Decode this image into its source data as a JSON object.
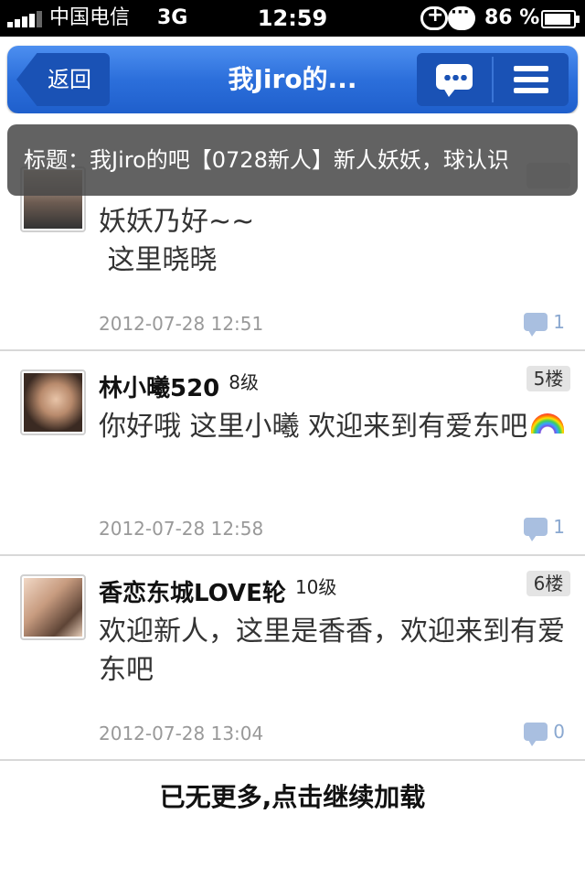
{
  "status_bar": {
    "carrier": "中国电信",
    "network": "3G",
    "time": "12:59",
    "battery": "86 %"
  },
  "nav": {
    "back_label": "返回",
    "title": "我Jiro的..."
  },
  "title_tip": "标题：我Jiro的吧【0728新人】新人妖妖，球认识",
  "posts": [
    {
      "name": "",
      "level": "",
      "floor": "",
      "content": "妖妖乃好~~\n 这里晓晓",
      "time": "2012-07-28 12:51",
      "replies": "1"
    },
    {
      "name": "林小曦520",
      "level": "8级",
      "floor": "5楼",
      "content": "你好哦 这里小曦 欢迎来到有爱东吧",
      "time": "2012-07-28 12:58",
      "replies": "1"
    },
    {
      "name": "香恋东城LOVE轮",
      "level": "10级",
      "floor": "6楼",
      "content": "欢迎新人，这里是香香，欢迎来到有爱东吧",
      "time": "2012-07-28 13:04",
      "replies": "0"
    }
  ],
  "load_more": "已无更多,点击继续加载",
  "colors": {
    "nav_blue": "#2c6fdb",
    "button_blue": "#1a52b5",
    "meta_gray": "#999999",
    "reply_blue": "#8aa8d0"
  }
}
